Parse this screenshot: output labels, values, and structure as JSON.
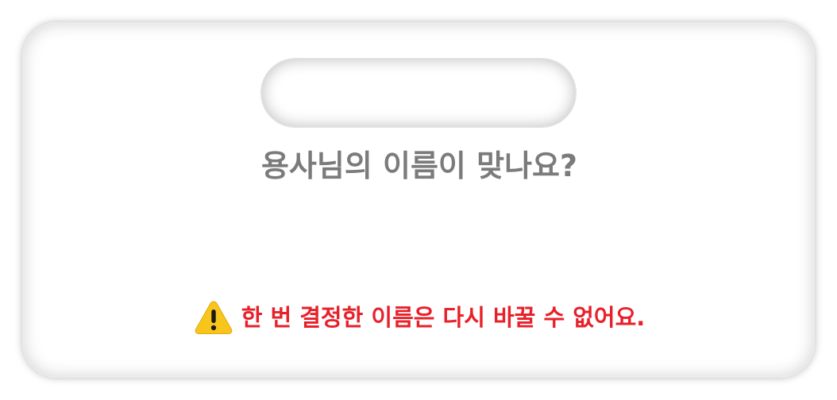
{
  "dialog": {
    "name_input": {
      "value": "",
      "placeholder": ""
    },
    "question": "용사님의 이름이 맞나요?",
    "warning": {
      "icon": "warning-triangle-icon",
      "text": "한 번 결정한 이름은 다시 바꿀 수 없어요."
    }
  },
  "colors": {
    "question_text": "#7b7b7b",
    "warning_text": "#e8202a",
    "warning_icon_fill": "#f7c51c",
    "warning_icon_mark": "#1a1a1a"
  }
}
